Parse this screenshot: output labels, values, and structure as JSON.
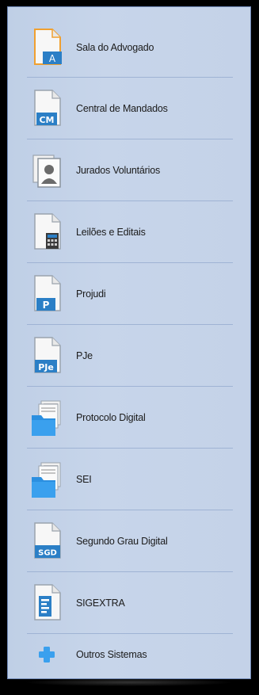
{
  "menu": {
    "items": [
      {
        "label": "Sala do Advogado",
        "icon": "document-a-icon"
      },
      {
        "label": "Central de Mandados",
        "icon": "document-cm-icon"
      },
      {
        "label": "Jurados Voluntários",
        "icon": "contact-card-icon"
      },
      {
        "label": "Leilões e Editais",
        "icon": "document-calculator-icon"
      },
      {
        "label": "Projudi",
        "icon": "document-p-icon"
      },
      {
        "label": "PJe",
        "icon": "document-pje-icon"
      },
      {
        "label": "Protocolo Digital",
        "icon": "folder-documents-icon"
      },
      {
        "label": "SEI",
        "icon": "folder-documents-icon"
      },
      {
        "label": "Segundo Grau Digital",
        "icon": "document-sgd-icon"
      },
      {
        "label": "SIGEXTRA",
        "icon": "document-lines-icon"
      },
      {
        "label": "Outros Sistemas",
        "icon": "plus-icon"
      }
    ]
  },
  "colors": {
    "panel_bg": "#c5d3e8",
    "panel_border": "#6f88b6",
    "separator": "#9fb3d4",
    "icon_blue": "#2b7fc6",
    "icon_orange": "#f0a030"
  }
}
